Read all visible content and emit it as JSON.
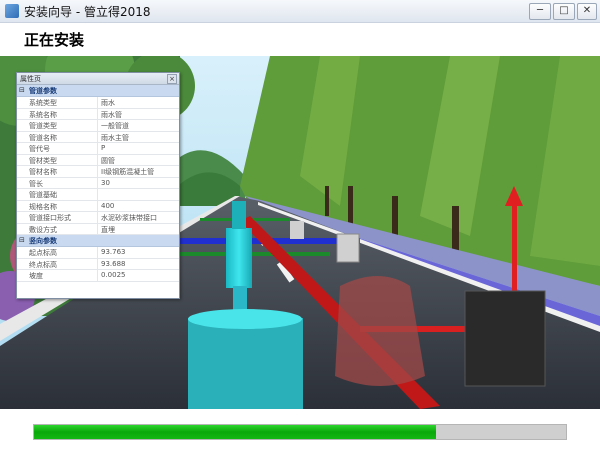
{
  "window": {
    "title": "安装向导 - 管立得2018",
    "minimize": "─",
    "maximize": "□",
    "close": "✕"
  },
  "header": {
    "title": "正在安装"
  },
  "property_panel": {
    "title": "属性页",
    "close": "×",
    "groups": [
      {
        "label": "管道参数",
        "rows": [
          {
            "key": "系统类型",
            "value": "雨水"
          },
          {
            "key": "系统名称",
            "value": "雨水管"
          },
          {
            "key": "管道类型",
            "value": "一般管道"
          },
          {
            "key": "管道名称",
            "value": "雨水主管"
          },
          {
            "key": "管代号",
            "value": "P"
          },
          {
            "key": "管材类型",
            "value": "圆管"
          },
          {
            "key": "管材名称",
            "value": "II级钢筋混凝土管"
          },
          {
            "key": "管长",
            "value": "30"
          },
          {
            "key": "管道基础",
            "value": ""
          },
          {
            "key": "规格名称",
            "value": "400"
          },
          {
            "key": "管道接口形式",
            "value": "水泥砂浆抹带接口"
          },
          {
            "key": "敷设方式",
            "value": "直埋"
          }
        ]
      },
      {
        "label": "竖向参数",
        "rows": [
          {
            "key": "起点标高",
            "value": "93.763"
          },
          {
            "key": "终点标高",
            "value": "93.688"
          },
          {
            "key": "坡度",
            "value": "0.0025"
          }
        ]
      }
    ]
  },
  "progress": {
    "fraction": 0.755
  },
  "colors": {
    "progress": "#0aa80a",
    "group_bg": "#c9daf0"
  }
}
